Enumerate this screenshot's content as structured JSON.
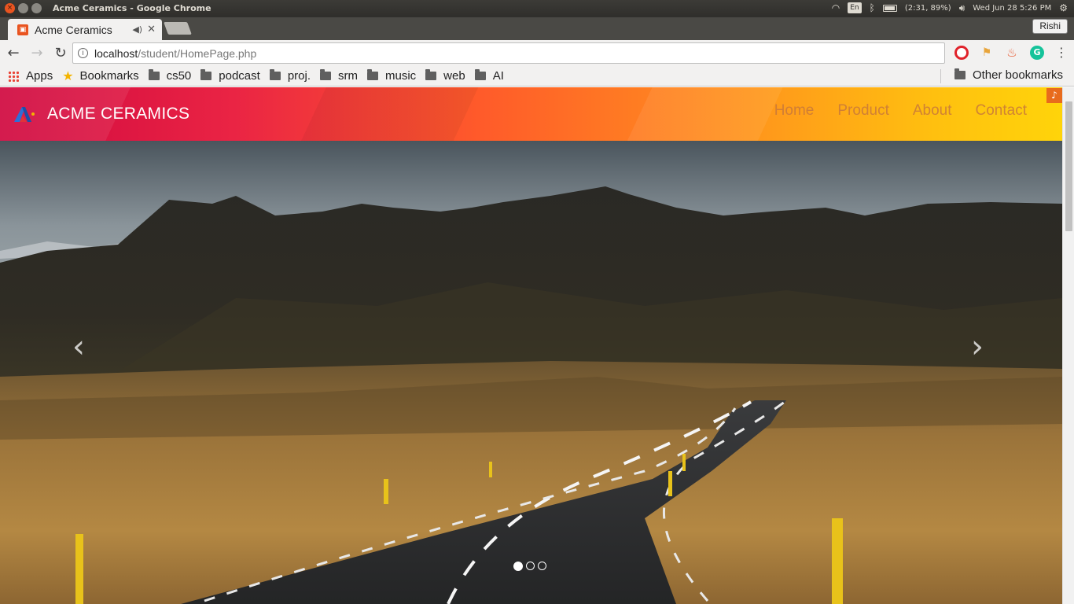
{
  "os": {
    "window_title": "Acme Ceramics - Google Chrome",
    "keyboard_layout": "En",
    "battery_text": "(2:31, 89%)",
    "clock": "Wed Jun 28  5:26 PM"
  },
  "browser": {
    "tab": {
      "title": "Acme Ceramics"
    },
    "profile_name": "Rishi",
    "url_host": "localhost",
    "url_path": "/student/HomePage.php",
    "bookmarks": [
      {
        "label": "Apps",
        "icon": "apps-icon"
      },
      {
        "label": "Bookmarks",
        "icon": "star-icon"
      },
      {
        "label": "cs50",
        "icon": "folder-icon"
      },
      {
        "label": "podcast",
        "icon": "folder-icon"
      },
      {
        "label": "proj.",
        "icon": "folder-icon"
      },
      {
        "label": "srm",
        "icon": "folder-icon"
      },
      {
        "label": "music",
        "icon": "folder-icon"
      },
      {
        "label": "web",
        "icon": "folder-icon"
      },
      {
        "label": "AI",
        "icon": "folder-icon"
      }
    ],
    "other_bookmarks": "Other bookmarks"
  },
  "site": {
    "brand": "ACME CERAMICS",
    "nav": [
      "Home",
      "Product",
      "About",
      "Contact"
    ],
    "colors": {
      "header_start": "#d0083f",
      "header_end": "#ffd40a",
      "nav_text": "#c8783b"
    },
    "carousel": {
      "prev_symbol": "‹",
      "next_symbol": "›",
      "slide_count": 3,
      "active_slide": 1
    }
  }
}
